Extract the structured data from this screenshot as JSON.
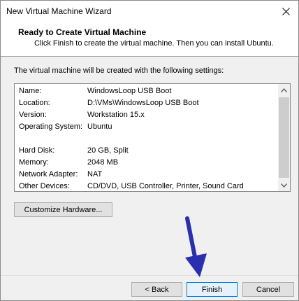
{
  "window": {
    "title": "New Virtual Machine Wizard"
  },
  "header": {
    "title": "Ready to Create Virtual Machine",
    "subtitle": "Click Finish to create the virtual machine. Then you can install Ubuntu."
  },
  "intro": "The virtual machine will be created with the following settings:",
  "settings": [
    {
      "key": "Name:",
      "value": "WindowsLoop USB Boot"
    },
    {
      "key": "Location:",
      "value": "D:\\VMs\\WindowsLoop USB Boot"
    },
    {
      "key": "Version:",
      "value": "Workstation 15.x"
    },
    {
      "key": "Operating System:",
      "value": "Ubuntu"
    },
    {
      "key": "",
      "value": ""
    },
    {
      "key": "Hard Disk:",
      "value": "20 GB, Split"
    },
    {
      "key": "Memory:",
      "value": "2048 MB"
    },
    {
      "key": "Network Adapter:",
      "value": "NAT"
    },
    {
      "key": "Other Devices:",
      "value": "CD/DVD, USB Controller, Printer, Sound Card"
    }
  ],
  "buttons": {
    "customize": "Customize Hardware...",
    "back": "< Back",
    "finish": "Finish",
    "cancel": "Cancel"
  },
  "colors": {
    "annotation_arrow": "#2a2fb0",
    "focus_border": "#0078d7"
  }
}
